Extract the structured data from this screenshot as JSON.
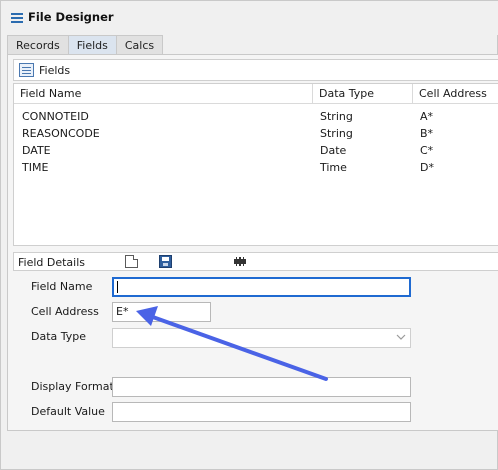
{
  "window": {
    "title": "File Designer",
    "icon": "list-icon"
  },
  "tabs": [
    {
      "label": "Records",
      "active": false
    },
    {
      "label": "Fields",
      "active": true
    },
    {
      "label": "Calcs",
      "active": false
    }
  ],
  "fields_panel": {
    "title": "Fields",
    "icon": "fields-grid-icon",
    "columns": [
      "Field Name",
      "Data Type",
      "Cell Address"
    ],
    "rows": [
      [
        "CONNOTEID",
        "String",
        "A*"
      ],
      [
        "REASONCODE",
        "String",
        "B*"
      ],
      [
        "DATE",
        "Date",
        "C*"
      ],
      [
        "TIME",
        "Time",
        "D*"
      ]
    ]
  },
  "details": {
    "title": "Field Details",
    "toolbar_icons": [
      "new-document-icon",
      "save-icon",
      "film-icon"
    ],
    "field_name": {
      "label": "Field Name",
      "value": ""
    },
    "cell_address": {
      "label": "Cell Address",
      "value": "E*"
    },
    "data_type": {
      "label": "Data Type",
      "value": ""
    },
    "display_format": {
      "label": "Display Format",
      "value": ""
    },
    "default_value": {
      "label": "Default Value",
      "value": ""
    }
  },
  "colors": {
    "focus_border": "#1f6ad1",
    "annotation_arrow": "#4a63e6",
    "save_icon": "#2f5f9e"
  }
}
